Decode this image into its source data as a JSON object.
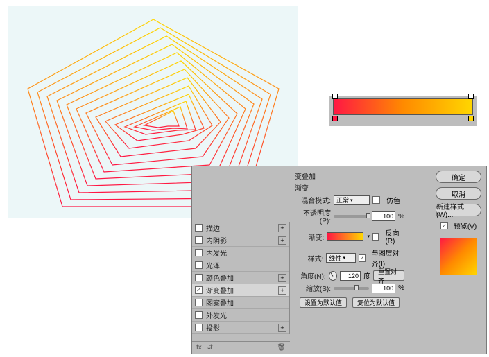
{
  "gradient_editor": {
    "stops": [
      {
        "position": 0,
        "color": "#ff1744"
      },
      {
        "position": 100,
        "color": "#ffd600"
      }
    ]
  },
  "dialog": {
    "title_partial": "变叠加",
    "section": "渐变",
    "styles": [
      {
        "label": "描边",
        "checked": false,
        "has_add": true
      },
      {
        "label": "内阴影",
        "checked": false,
        "has_add": true
      },
      {
        "label": "内发光",
        "checked": false,
        "has_add": false
      },
      {
        "label": "光泽",
        "checked": false,
        "has_add": false
      },
      {
        "label": "颜色叠加",
        "checked": false,
        "has_add": true
      },
      {
        "label": "渐变叠加",
        "checked": true,
        "has_add": true,
        "active": true
      },
      {
        "label": "图案叠加",
        "checked": false,
        "has_add": false
      },
      {
        "label": "外发光",
        "checked": false,
        "has_add": false
      },
      {
        "label": "投影",
        "checked": false,
        "has_add": true
      }
    ],
    "blend_mode": {
      "label": "混合模式:",
      "value": "正常",
      "dither_label": "仿色",
      "dither": false
    },
    "opacity": {
      "label": "不透明度(P):",
      "value": "100",
      "unit": "%"
    },
    "gradient": {
      "label": "渐变:",
      "reverse_label": "反向(R)",
      "reverse": false
    },
    "style": {
      "label": "样式:",
      "value": "线性",
      "align_label": "与图层对齐(I)",
      "align": true
    },
    "angle": {
      "label": "角度(N):",
      "value": "120",
      "unit": "度",
      "reset": "重置对齐"
    },
    "scale": {
      "label": "缩放(S):",
      "value": "100",
      "unit": "%"
    },
    "default_buttons": {
      "set": "设置为默认值",
      "reset": "复位为默认值"
    },
    "buttons": {
      "ok": "确定",
      "cancel": "取消",
      "newstyle": "新建样式(W)...",
      "preview_label": "预览(V)",
      "preview_checked": true
    }
  }
}
